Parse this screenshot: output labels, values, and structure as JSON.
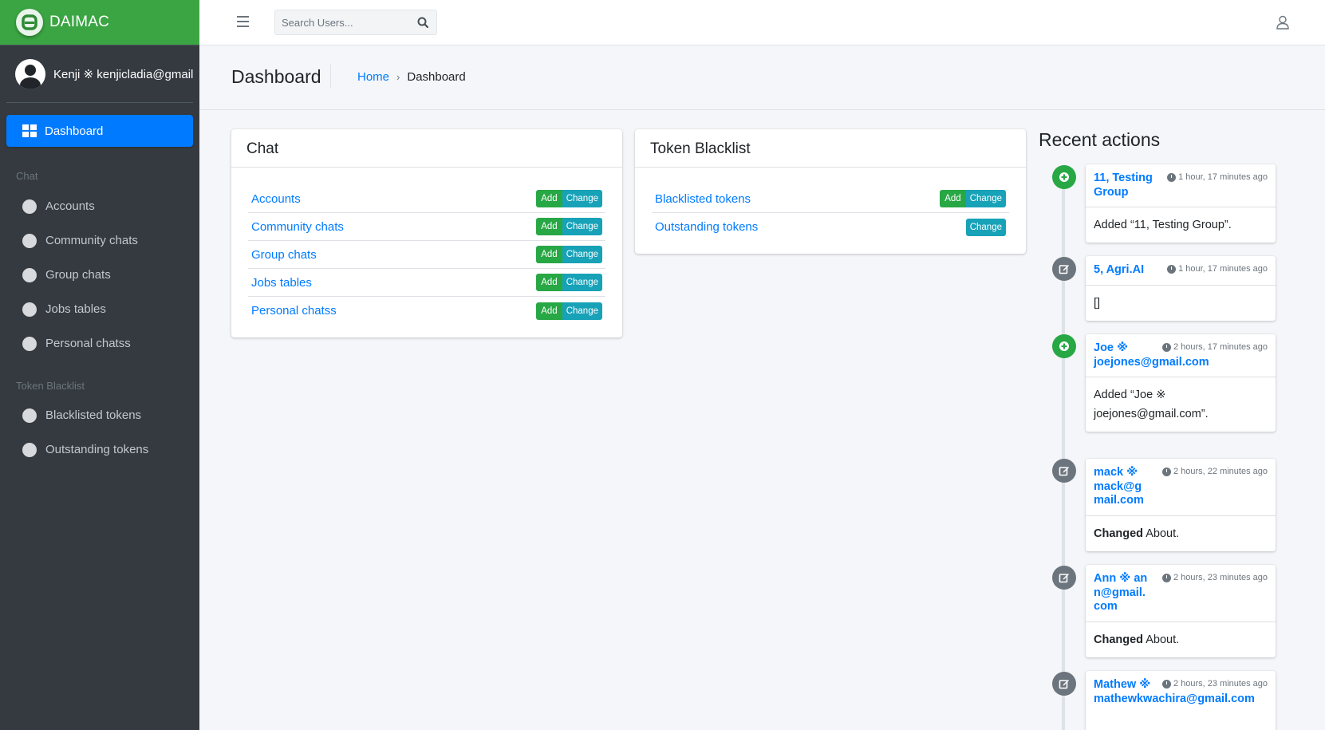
{
  "brand": {
    "name": "DAIMAC",
    "logo_letter": "A",
    "color": "#3aa542"
  },
  "user": {
    "display": "Kenji ※ kenjicladia@gmail.com"
  },
  "sidebar": {
    "active": {
      "label": "Dashboard"
    },
    "sections": [
      {
        "header": "Chat",
        "items": [
          "Accounts",
          "Community chats",
          "Group chats",
          "Jobs tables",
          "Personal chatss"
        ]
      },
      {
        "header": "Token Blacklist",
        "items": [
          "Blacklisted tokens",
          "Outstanding tokens"
        ]
      }
    ]
  },
  "topbar": {
    "search_placeholder": "Search Users..."
  },
  "header": {
    "title": "Dashboard",
    "breadcrumb_home": "Home",
    "breadcrumb_current": "Dashboard"
  },
  "labels": {
    "add": "Add",
    "change": "Change"
  },
  "cards": {
    "chat": {
      "title": "Chat",
      "rows": [
        {
          "label": "Accounts",
          "add": true
        },
        {
          "label": "Community chats",
          "add": true
        },
        {
          "label": "Group chats",
          "add": true
        },
        {
          "label": "Jobs tables",
          "add": true
        },
        {
          "label": "Personal chatss",
          "add": true
        }
      ]
    },
    "token": {
      "title": "Token Blacklist",
      "rows": [
        {
          "label": "Blacklisted tokens",
          "add": true
        },
        {
          "label": "Outstanding tokens",
          "add": false
        }
      ]
    }
  },
  "recent": {
    "title": "Recent actions",
    "items": [
      {
        "type": "add",
        "link": "11, Testing Group",
        "time": "1 hour, 17 minutes ago",
        "body_bold": "",
        "body": "Added “11, Testing Group”."
      },
      {
        "type": "change",
        "link": "5, Agri.AI",
        "time": "1 hour, 17 minutes ago",
        "body_bold": "",
        "body": "[]"
      },
      {
        "type": "add",
        "link": "Joe ※ joejones@gmail.com",
        "time": "2 hours, 17 minutes ago",
        "body_bold": "",
        "body": "Added “Joe ※ joejones@gmail.com”."
      },
      {
        "type": "change",
        "link": "mack ※ mack@gmail.com",
        "time": "2 hours, 22 minutes ago",
        "body_bold": "Changed",
        "body": " About."
      },
      {
        "type": "change",
        "link": "Ann ※ ann@gmail.com",
        "time": "2 hours, 23 minutes ago",
        "body_bold": "Changed",
        "body": " About."
      },
      {
        "type": "change",
        "link": "Mathew ※ mathewkwachira@gmail.com",
        "time": "2 hours, 23 minutes ago",
        "body_bold": "",
        "body": ""
      }
    ]
  }
}
